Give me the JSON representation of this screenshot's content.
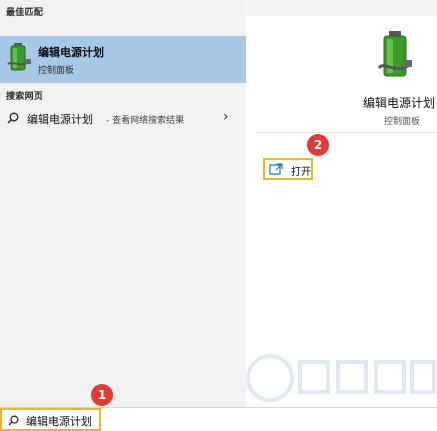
{
  "results": {
    "best_match_header": "最佳匹配",
    "best_match": {
      "title": "编辑电源计划",
      "subtitle": "控制面板"
    },
    "web_header": "搜索网页",
    "web_result": {
      "query": "编辑电源计划",
      "description": "- 查看网络搜索结果",
      "arrow": "›"
    }
  },
  "detail": {
    "title": "编辑电源计划",
    "subtitle": "控制面板",
    "open_label": "打开"
  },
  "badges": {
    "search": "1",
    "open": "2"
  },
  "search": {
    "value": "编辑电源计划"
  },
  "icons": {
    "app": "battery-power-plan-icon",
    "web": "search-icon",
    "open": "open-window-icon"
  },
  "colors": {
    "selection": "#a8c8e8",
    "highlight_border": "#f0b429",
    "badge": "#e53935",
    "panel_bg": "#f2f2f2"
  }
}
